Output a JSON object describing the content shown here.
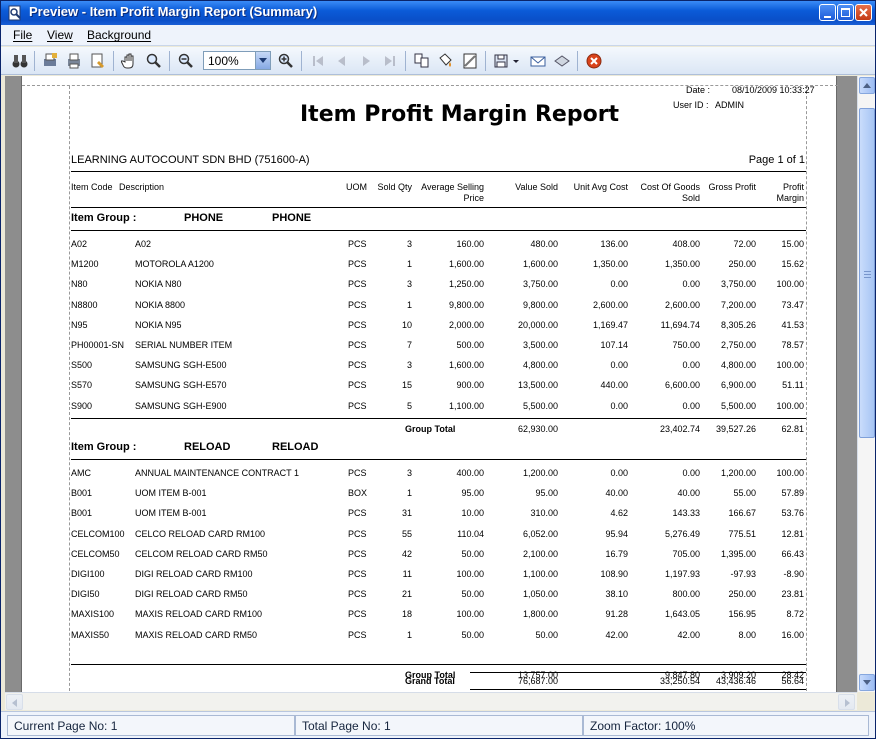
{
  "window": {
    "title": "Preview - Item Profit Margin Report (Summary)"
  },
  "menu": {
    "items": [
      "File",
      "View",
      "Background"
    ]
  },
  "toolbar": {
    "zoom_value": "100%"
  },
  "report": {
    "title": "Item Profit Margin Report",
    "date_label": "Date :",
    "date_value": "08/10/2009 10:33:27",
    "user_label": "User ID :",
    "user_value": "ADMIN",
    "company": "LEARNING AUTOCOUNT SDN BHD (751600-A)",
    "page_info": "Page 1 of 1",
    "columns": {
      "item_code": "Item Code",
      "description": "Description",
      "uom": "UOM",
      "sold_qty": "Sold Qty",
      "avg_price_1": "Average Selling",
      "avg_price_2": "Price",
      "value_sold": "Value Sold",
      "unit_avg_cost": "Unit Avg Cost",
      "cogs_1": "Cost Of Goods",
      "cogs_2": "Sold",
      "gross_profit": "Gross Profit",
      "margin_1": "Profit",
      "margin_2": "Margin"
    },
    "group_label": "Item Group :",
    "groups": [
      {
        "code": "PHONE",
        "name": "PHONE",
        "rows": [
          [
            "A02",
            "A02",
            "PCS",
            "3",
            "160.00",
            "480.00",
            "136.00",
            "408.00",
            "72.00",
            "15.00"
          ],
          [
            "M1200",
            "MOTOROLA A1200",
            "PCS",
            "1",
            "1,600.00",
            "1,600.00",
            "1,350.00",
            "1,350.00",
            "250.00",
            "15.62"
          ],
          [
            "N80",
            "NOKIA N80",
            "PCS",
            "3",
            "1,250.00",
            "3,750.00",
            "0.00",
            "0.00",
            "3,750.00",
            "100.00"
          ],
          [
            "N8800",
            "NOKIA 8800",
            "PCS",
            "1",
            "9,800.00",
            "9,800.00",
            "2,600.00",
            "2,600.00",
            "7,200.00",
            "73.47"
          ],
          [
            "N95",
            "NOKIA N95",
            "PCS",
            "10",
            "2,000.00",
            "20,000.00",
            "1,169.47",
            "11,694.74",
            "8,305.26",
            "41.53"
          ],
          [
            "PH00001-SN",
            "SERIAL NUMBER ITEM",
            "PCS",
            "7",
            "500.00",
            "3,500.00",
            "107.14",
            "750.00",
            "2,750.00",
            "78.57"
          ],
          [
            "S500",
            "SAMSUNG SGH-E500",
            "PCS",
            "3",
            "1,600.00",
            "4,800.00",
            "0.00",
            "0.00",
            "4,800.00",
            "100.00"
          ],
          [
            "S570",
            "SAMSUNG SGH-E570",
            "PCS",
            "15",
            "900.00",
            "13,500.00",
            "440.00",
            "6,600.00",
            "6,900.00",
            "51.11"
          ],
          [
            "S900",
            "SAMSUNG SGH-E900",
            "PCS",
            "5",
            "1,100.00",
            "5,500.00",
            "0.00",
            "0.00",
            "5,500.00",
            "100.00"
          ]
        ],
        "total_label": "Group Total",
        "total": [
          "62,930.00",
          "23,402.74",
          "39,527.26",
          "62.81"
        ]
      },
      {
        "code": "RELOAD",
        "name": "RELOAD",
        "rows": [
          [
            "AMC",
            "ANNUAL MAINTENANCE CONTRACT 1",
            "PCS",
            "3",
            "400.00",
            "1,200.00",
            "0.00",
            "0.00",
            "1,200.00",
            "100.00"
          ],
          [
            "B001",
            "UOM ITEM B-001",
            "BOX",
            "1",
            "95.00",
            "95.00",
            "40.00",
            "40.00",
            "55.00",
            "57.89"
          ],
          [
            "B001",
            "UOM ITEM B-001",
            "PCS",
            "31",
            "10.00",
            "310.00",
            "4.62",
            "143.33",
            "166.67",
            "53.76"
          ],
          [
            "CELCOM100",
            "CELCO  RELOAD CARD RM100",
            "PCS",
            "55",
            "110.04",
            "6,052.00",
            "95.94",
            "5,276.49",
            "775.51",
            "12.81"
          ],
          [
            "CELCOM50",
            "CELCOM RELOAD CARD RM50",
            "PCS",
            "42",
            "50.00",
            "2,100.00",
            "16.79",
            "705.00",
            "1,395.00",
            "66.43"
          ],
          [
            "DIGI100",
            "DIGI RELOAD CARD RM100",
            "PCS",
            "11",
            "100.00",
            "1,100.00",
            "108.90",
            "1,197.93",
            "-97.93",
            "-8.90"
          ],
          [
            "DIGI50",
            "DIGI RELOAD CARD RM50",
            "PCS",
            "21",
            "50.00",
            "1,050.00",
            "38.10",
            "800.00",
            "250.00",
            "23.81"
          ],
          [
            "MAXIS100",
            "MAXIS RELOAD CARD RM100",
            "PCS",
            "18",
            "100.00",
            "1,800.00",
            "91.28",
            "1,643.05",
            "156.95",
            "8.72"
          ],
          [
            "MAXIS50",
            "MAXIS RELOAD CARD RM50",
            "PCS",
            "1",
            "50.00",
            "50.00",
            "42.00",
            "42.00",
            "8.00",
            "16.00"
          ]
        ],
        "total_label": "Group Total",
        "total": [
          "13,757.00",
          "9,847.80",
          "3,909.20",
          "28.42"
        ]
      }
    ],
    "grand_total_label": "Grand Total",
    "grand_total": [
      "76,687.00",
      "33,250.54",
      "43,436.46",
      "56.64"
    ]
  },
  "status": {
    "current_page": "Current Page No: 1",
    "total_page": "Total Page No: 1",
    "zoom_factor": "Zoom Factor: 100%"
  }
}
